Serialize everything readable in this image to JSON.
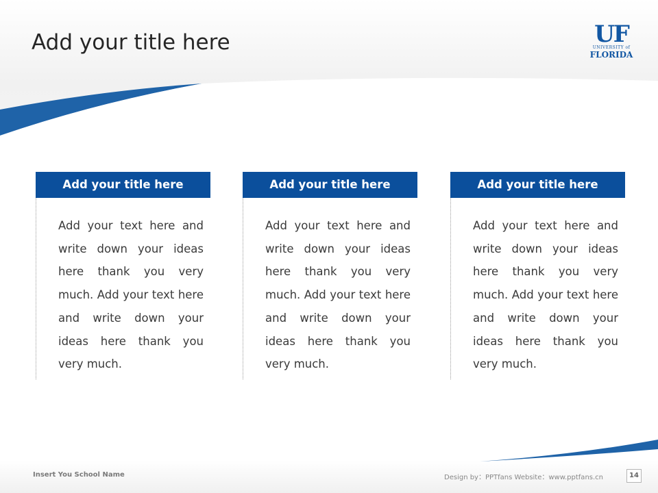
{
  "slide": {
    "title": "Add your title here",
    "logo": {
      "name": "University of Florida",
      "mark": "UF",
      "line1": "UNIVERSITY of",
      "line2": "FLORIDA"
    },
    "accent_color": "#0b4f9c",
    "cards": [
      {
        "title": "Add your title here",
        "text": "Add your text here and write down your ideas here thank you very much. Add your text here and write down your ideas here thank you very much."
      },
      {
        "title": "Add your title here",
        "text": "Add your text here and write down your ideas here thank you very much. Add your text here and write down your ideas here thank you very much."
      },
      {
        "title": "Add your title here",
        "text": "Add your text here and write down your ideas here thank you very much. Add your text here and write down your ideas here thank you very much."
      }
    ]
  },
  "footer": {
    "school_name": "Insert You School Name",
    "credit": "Design by：PPTfans   Website：www.pptfans.cn",
    "page_number": "14"
  }
}
